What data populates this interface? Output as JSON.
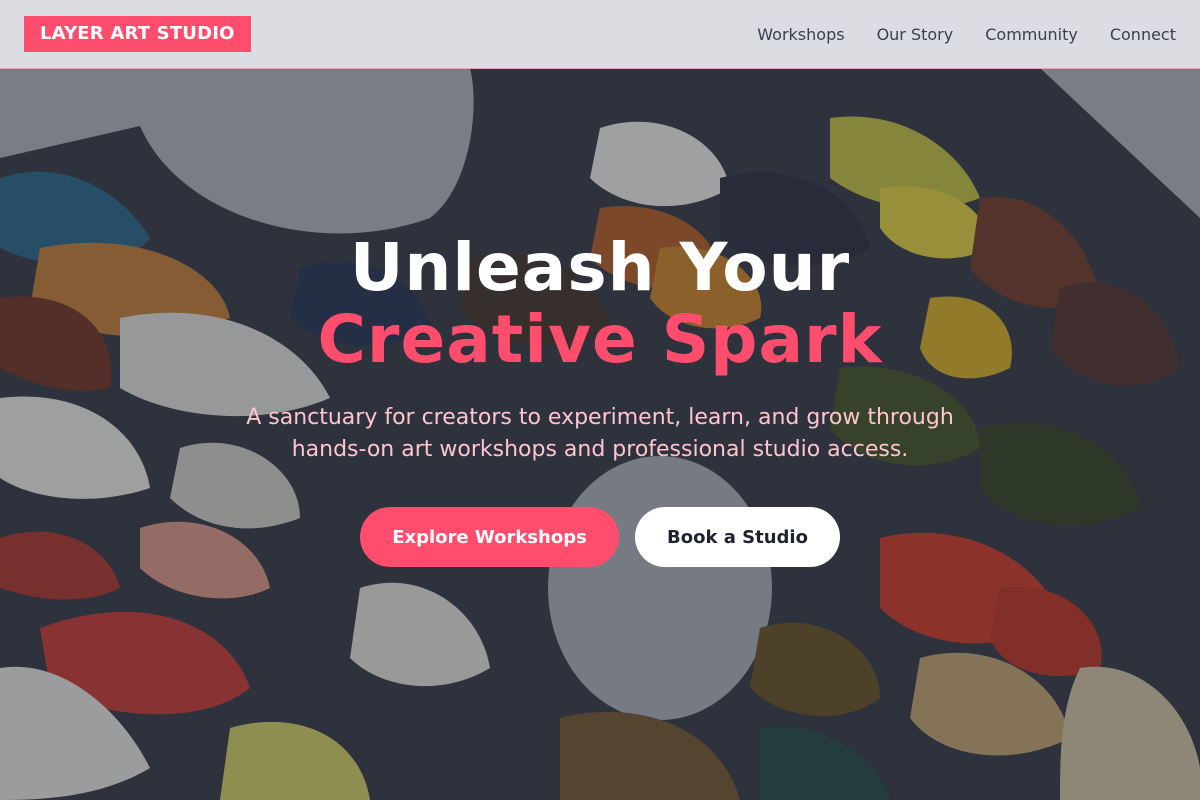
{
  "brand": {
    "logo_text": "LAYER ART STUDIO"
  },
  "nav": {
    "items": [
      {
        "label": "Workshops"
      },
      {
        "label": "Our Story"
      },
      {
        "label": "Community"
      },
      {
        "label": "Connect"
      }
    ]
  },
  "hero": {
    "headline_line1": "Unleash Your",
    "headline_line2": "Creative Spark",
    "subtitle_line1": "A sanctuary for creators to experiment, learn, and grow through",
    "subtitle_line2": "hands-on art workshops and professional studio access.",
    "primary_cta": "Explore Workshops",
    "secondary_cta": "Book a Studio"
  },
  "colors": {
    "accent": "#ff4d6d",
    "header_bg": "#e2e3e7",
    "subtitle": "#ffc4cf"
  }
}
